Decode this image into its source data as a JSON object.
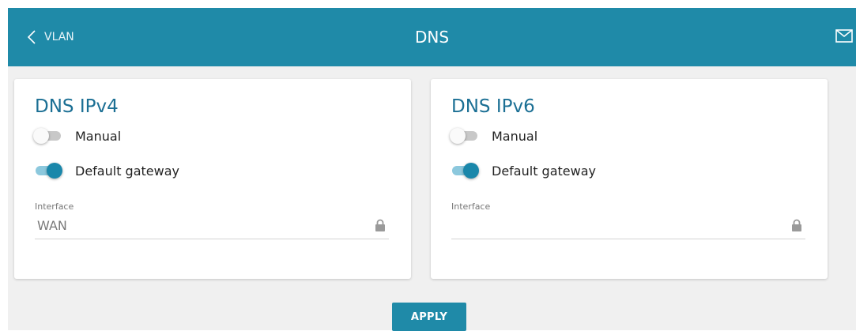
{
  "header": {
    "back_label": "VLAN",
    "back_icon": "chevron-left-icon",
    "title": "DNS",
    "mail_icon": "envelope-icon"
  },
  "ipv4": {
    "title": "DNS IPv4",
    "manual": {
      "label": "Manual",
      "enabled": false
    },
    "default_gateway": {
      "label": "Default gateway",
      "enabled": true
    },
    "interface": {
      "label": "Interface",
      "value": "WAN",
      "locked": true,
      "icon": "lock-icon"
    }
  },
  "ipv6": {
    "title": "DNS IPv6",
    "manual": {
      "label": "Manual",
      "enabled": false
    },
    "default_gateway": {
      "label": "Default gateway",
      "enabled": true
    },
    "interface": {
      "label": "Interface",
      "value": "",
      "locked": true,
      "icon": "lock-icon"
    }
  },
  "actions": {
    "apply_label": "APPLY"
  },
  "colors": {
    "header_bg": "#1f8aa8",
    "title_blue": "#1b6f94",
    "toggle_on": "#1a87aa",
    "page_bg": "#f0f0f0"
  }
}
